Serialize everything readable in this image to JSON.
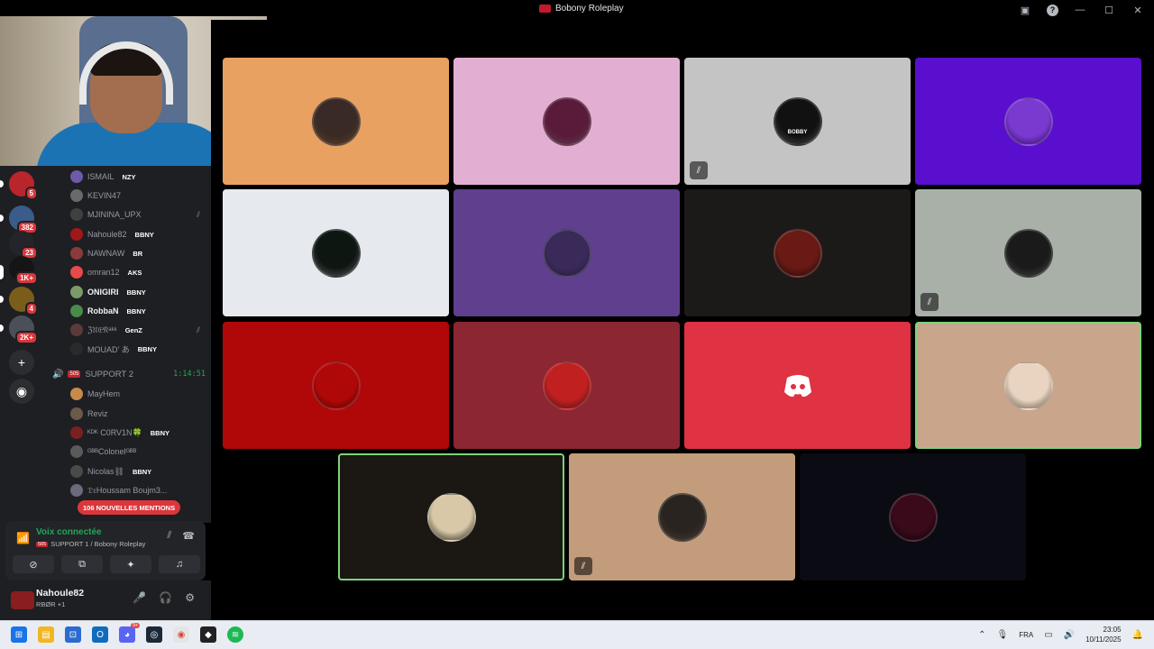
{
  "window": {
    "title": "Bobony Roleplay",
    "controls": [
      "display-icon",
      "help-icon",
      "minimize-icon",
      "maximize-icon",
      "close-icon"
    ]
  },
  "servers": [
    {
      "name": "server-1",
      "badge": "5",
      "color": "#b8252a"
    },
    {
      "name": "server-2",
      "badge": "382",
      "color": "#3a5c8a"
    },
    {
      "name": "server-3",
      "badge": "23",
      "color": "#23252a"
    },
    {
      "name": "server-4",
      "badge": "1K+",
      "color": "#151515"
    },
    {
      "name": "server-5",
      "badge": "4",
      "color": "#7a5d1a"
    },
    {
      "name": "server-6",
      "badge": "2K+",
      "color": "#4b4f57"
    }
  ],
  "channel_members_top": [
    {
      "name": "ISMAIL",
      "tag": "NZY",
      "bright": false,
      "muted": false,
      "avatar": "#6d5aa8"
    },
    {
      "name": "KEVIN47",
      "tag": "",
      "bright": false,
      "muted": false,
      "avatar": "#6a6a6a"
    },
    {
      "name": "MJININA_UPX",
      "tag": "",
      "bright": false,
      "muted": true,
      "avatar": "#404040"
    },
    {
      "name": "Nahoule82",
      "tag": "BBNY",
      "bright": false,
      "muted": false,
      "avatar": "#a01818"
    },
    {
      "name": "NAWNAW",
      "tag": "BR",
      "bright": false,
      "muted": false,
      "avatar": "#8a3a3a"
    },
    {
      "name": "omran12",
      "tag": "AKS",
      "bright": false,
      "muted": false,
      "avatar": "#e84a4a"
    },
    {
      "name": "ONIGIRI",
      "tag": "BBNY",
      "bright": true,
      "muted": false,
      "avatar": "#7a9a6a"
    },
    {
      "name": "RobbaN",
      "tag": "BBNY",
      "bright": true,
      "muted": false,
      "avatar": "#4a8a4a"
    },
    {
      "name": "ℨ𝔘𝔈𝔑ᵃᵏᵏ",
      "tag": "GenZ",
      "bright": false,
      "muted": true,
      "avatar": "#5a3a3a"
    },
    {
      "name": "MOUAD' あ",
      "tag": "BBNY",
      "bright": false,
      "muted": false,
      "avatar": "#2a2a2a"
    }
  ],
  "voice_channel": {
    "num": "505",
    "name": "SUPPORT 2",
    "timer": "1:14:51"
  },
  "channel_members_bottom": [
    {
      "name": "MayHem",
      "tag": "",
      "bright": false,
      "avatar": "#c88a4a"
    },
    {
      "name": "Reviz",
      "tag": "",
      "bright": false,
      "avatar": "#6a5a4a"
    },
    {
      "name": "ᴷᴰᴷ C0RV1N🍀",
      "tag": "BBNY",
      "bright": false,
      "avatar": "#7a2020"
    },
    {
      "name": "ᴳᴮᴮColonelᴳᴮᴮ",
      "tag": "",
      "bright": false,
      "avatar": "#5a5a5a"
    },
    {
      "name": "Nicolas⛓",
      "tag": "BBNY",
      "bright": false,
      "avatar": "#4a4a4a"
    },
    {
      "name": "𝔇𝔯Houssam Boujm3...",
      "tag": "",
      "bright": false,
      "avatar": "#6a6a7a"
    }
  ],
  "mentions": "106 NOUVELLES MENTIONS",
  "voice_panel": {
    "status": "Voix connectée",
    "channel_num": "505",
    "where": "SUPPORT 1 / Bobony Roleplay"
  },
  "user": {
    "name": "Nahoule82",
    "status": "RBØR +1"
  },
  "tiles_row1": [
    {
      "bg": "#e8a160",
      "avatar": "#3a2a25",
      "muted": false,
      "speaking": false,
      "label": ""
    },
    {
      "bg": "#e2afd2",
      "avatar": "#5a1a3a",
      "muted": false,
      "speaking": false,
      "label": ""
    },
    {
      "bg": "#c4c4c4",
      "avatar": "#111111",
      "muted": true,
      "speaking": false,
      "label": "BOBBY"
    },
    {
      "bg": "#5a0fce",
      "avatar": "#7a3ad0",
      "muted": false,
      "speaking": false,
      "label": ""
    }
  ],
  "tiles_row2": [
    {
      "bg": "#e6e9ee",
      "avatar": "#0e1612",
      "muted": false,
      "speaking": false,
      "label": ""
    },
    {
      "bg": "#5f3f8e",
      "avatar": "#3a2a5a",
      "muted": false,
      "speaking": false,
      "label": ""
    },
    {
      "bg": "#1c1a18",
      "avatar": "#6a1a15",
      "muted": false,
      "speaking": false,
      "label": ""
    },
    {
      "bg": "#a8b0a8",
      "avatar": "#1a1a1a",
      "muted": true,
      "speaking": false,
      "label": ""
    }
  ],
  "tiles_row3": [
    {
      "bg": "#b00808",
      "avatar": "#b00808",
      "muted": false,
      "speaking": false,
      "label": ""
    },
    {
      "bg": "#8c2633",
      "avatar": "#c12020",
      "muted": false,
      "speaking": false,
      "label": ""
    },
    {
      "bg": "#df3242",
      "avatar": "#df3242",
      "muted": false,
      "speaking": false,
      "label": "",
      "discord": true
    },
    {
      "bg": "#c9a58c",
      "avatar": "#e8d4c0",
      "muted": false,
      "speaking": true,
      "label": ""
    }
  ],
  "tiles_row4": [
    {
      "bg": "#1b1814",
      "avatar": "#d8c8a8",
      "muted": false,
      "speaking": true,
      "label": ""
    },
    {
      "bg": "#c39c7b",
      "avatar": "#2a2420",
      "muted": true,
      "speaking": false,
      "label": ""
    },
    {
      "bg": "#0b0b14",
      "avatar": "#3a0a1a",
      "muted": false,
      "speaking": false,
      "label": ""
    }
  ],
  "taskbar": {
    "apps": [
      "windows-icon",
      "file-explorer-icon",
      "store-icon",
      "outlook-icon",
      "discord-icon",
      "steam-icon",
      "chrome-icon",
      "app-icon",
      "spotify-icon"
    ],
    "discord_badge": "9+",
    "language": "FRA",
    "time": "23:05",
    "date": "10/11/2025"
  }
}
